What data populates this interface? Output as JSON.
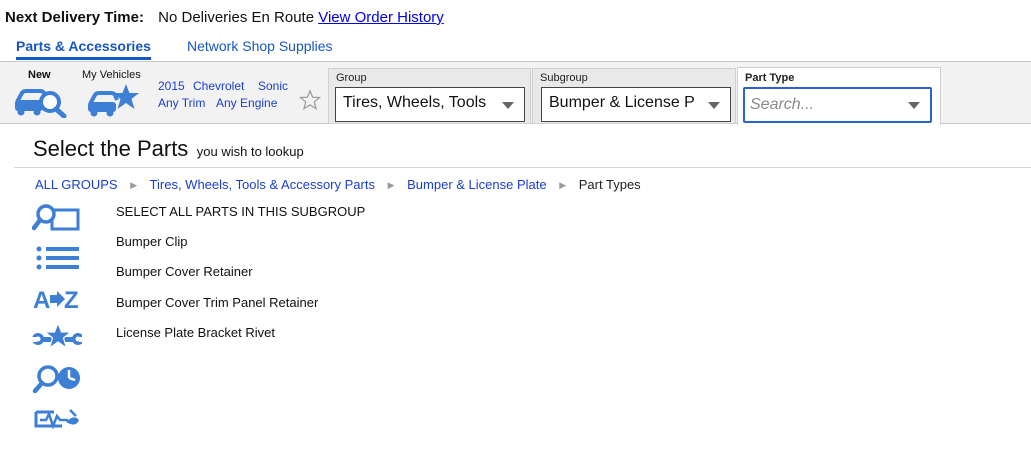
{
  "delivery": {
    "label": "Next Delivery Time:",
    "status": "No Deliveries En Route",
    "history_link": "View Order History"
  },
  "tabs": [
    {
      "label": "Parts & Accessories",
      "active": true
    },
    {
      "label": "Network Shop Supplies",
      "active": false
    }
  ],
  "toolbar": {
    "new_label": "New",
    "my_vehicles_label": "My Vehicles",
    "vehicle": {
      "year": "2015",
      "make": "Chevrolet",
      "model": "Sonic",
      "trim": "Any Trim",
      "engine": "Any Engine"
    },
    "group": {
      "title": "Group",
      "value": "Tires, Wheels, Tools"
    },
    "subgroup": {
      "title": "Subgroup",
      "value": "Bumper & License P"
    },
    "part_type": {
      "title": "Part Type",
      "placeholder": "Search..."
    }
  },
  "heading": {
    "title": "Select the Parts",
    "subtitle": "you wish to lookup"
  },
  "breadcrumb": {
    "items": [
      "ALL GROUPS",
      "Tires, Wheels, Tools & Accessory Parts",
      "Bumper & License Plate"
    ],
    "current": "Part Types"
  },
  "parts": [
    "SELECT ALL PARTS IN THIS SUBGROUP",
    "Bumper Clip",
    "Bumper Cover Retainer",
    "Bumper Cover Trim Panel Retainer",
    "License Plate Bracket Rivet"
  ],
  "side_icons": [
    "search-part-icon",
    "list-icon",
    "a-to-z-icon",
    "wrench-star-icon",
    "search-clock-icon",
    "vehicle-diagnostic-icon"
  ],
  "colors": {
    "link": "#1a3fcf",
    "icon": "#3d7fd4",
    "tab_accent": "#1857c0",
    "toolbar_bg": "#f2f2f2",
    "focus_border": "#2a64c8"
  }
}
